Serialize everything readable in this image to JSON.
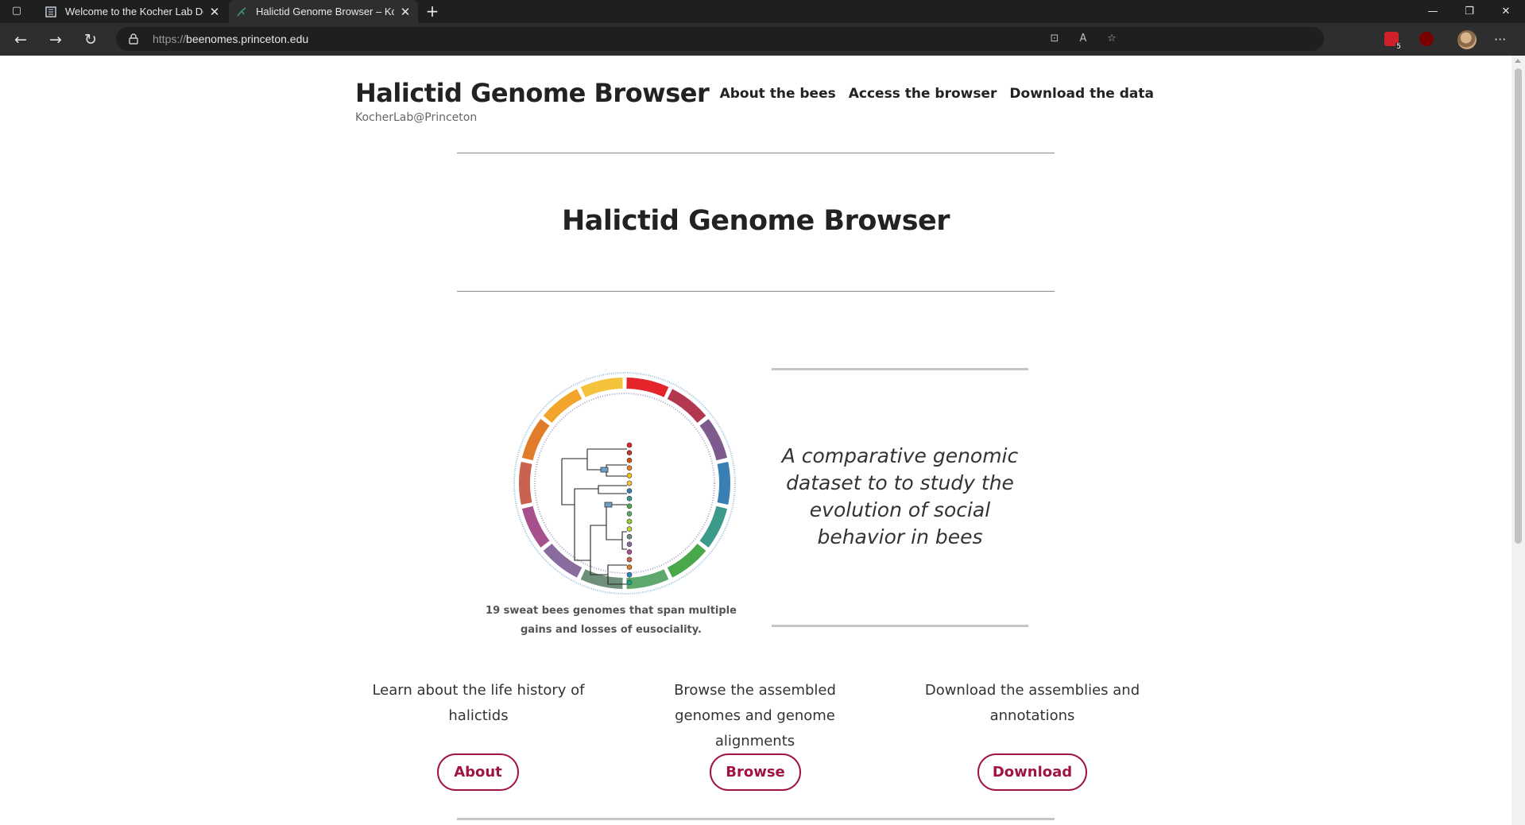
{
  "browser": {
    "tabs": [
      {
        "title": "Welcome to the Kocher Lab Docs",
        "active": false
      },
      {
        "title": "Halictid Genome Browser – Kocher Lab",
        "active": true
      }
    ],
    "url_scheme": "https://",
    "url_host": "beenomes.princeton.edu",
    "extension_badge": "5"
  },
  "site": {
    "title": "Halictid Genome Browser",
    "subtitle": "KocherLab@Princeton",
    "nav": [
      "About the bees",
      "Access the browser",
      "Download the data"
    ]
  },
  "hero": {
    "title": "Halictid Genome Browser",
    "figure_caption": "19 sweat bees genomes that span multiple gains and losses of eusociality.",
    "tagline": "A comparative genomic dataset to to study the evolution of social behavior in bees"
  },
  "features": [
    {
      "text": "Learn about the life history of halictids",
      "button": "About"
    },
    {
      "text": "Browse the assembled genomes and genome alignments",
      "button": "Browse"
    },
    {
      "text": "Download the assemblies and annotations",
      "button": "Download"
    }
  ],
  "colors": {
    "accent": "#a01444",
    "ring": [
      "#e3242b",
      "#b2374f",
      "#7e5b8f",
      "#3a7fb4",
      "#3b9a8a",
      "#4aa84c",
      "#5fa86b",
      "#6f8f7a",
      "#8a6b9e",
      "#a7508e",
      "#c9624f",
      "#e07c2a",
      "#f2a52a",
      "#f5c33b"
    ]
  }
}
